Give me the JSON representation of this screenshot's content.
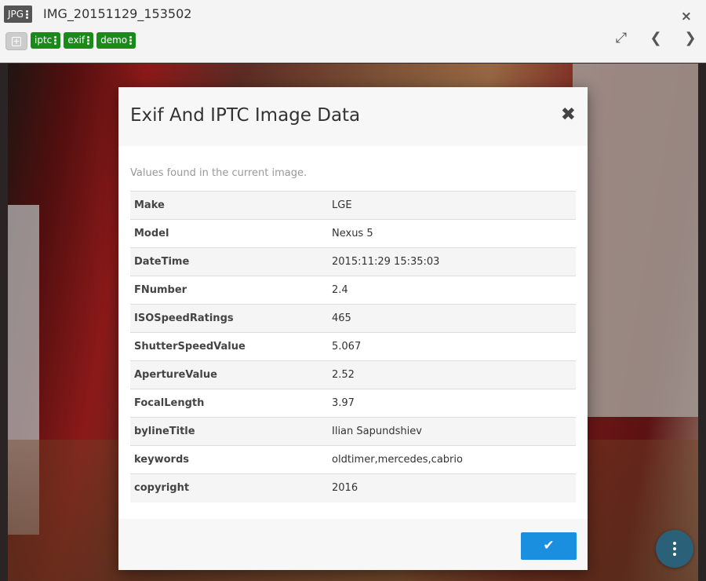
{
  "header": {
    "file_type": "JPG",
    "title": "IMG_20151129_153502",
    "close_icon": "×",
    "tags": [
      {
        "label": "iptc"
      },
      {
        "label": "exif"
      },
      {
        "label": "demo"
      }
    ],
    "fullscreen_icon": "⤢",
    "prev_icon": "❮",
    "next_icon": "❯",
    "tag_color": "#1b8a1b"
  },
  "modal": {
    "title": "Exif And IPTC Image Data",
    "close_icon": "✖",
    "caption": "Values found in the current image.",
    "rows": [
      {
        "key": "Make",
        "value": "LGE"
      },
      {
        "key": "Model",
        "value": "Nexus 5"
      },
      {
        "key": "DateTime",
        "value": "2015:11:29 15:35:03"
      },
      {
        "key": "FNumber",
        "value": "2.4"
      },
      {
        "key": "ISOSpeedRatings",
        "value": "465"
      },
      {
        "key": "ShutterSpeedValue",
        "value": "5.067"
      },
      {
        "key": "ApertureValue",
        "value": "2.52"
      },
      {
        "key": "FocalLength",
        "value": "3.97"
      },
      {
        "key": "bylineTitle",
        "value": "Ilian Sapundshiev"
      },
      {
        "key": "keywords",
        "value": "oldtimer,mercedes,cabrio"
      },
      {
        "key": "copyright",
        "value": "2016"
      }
    ],
    "ok_icon": "✔",
    "accent_color": "#1a8fe0"
  },
  "fab": {
    "icon": "more-vertical-icon"
  }
}
